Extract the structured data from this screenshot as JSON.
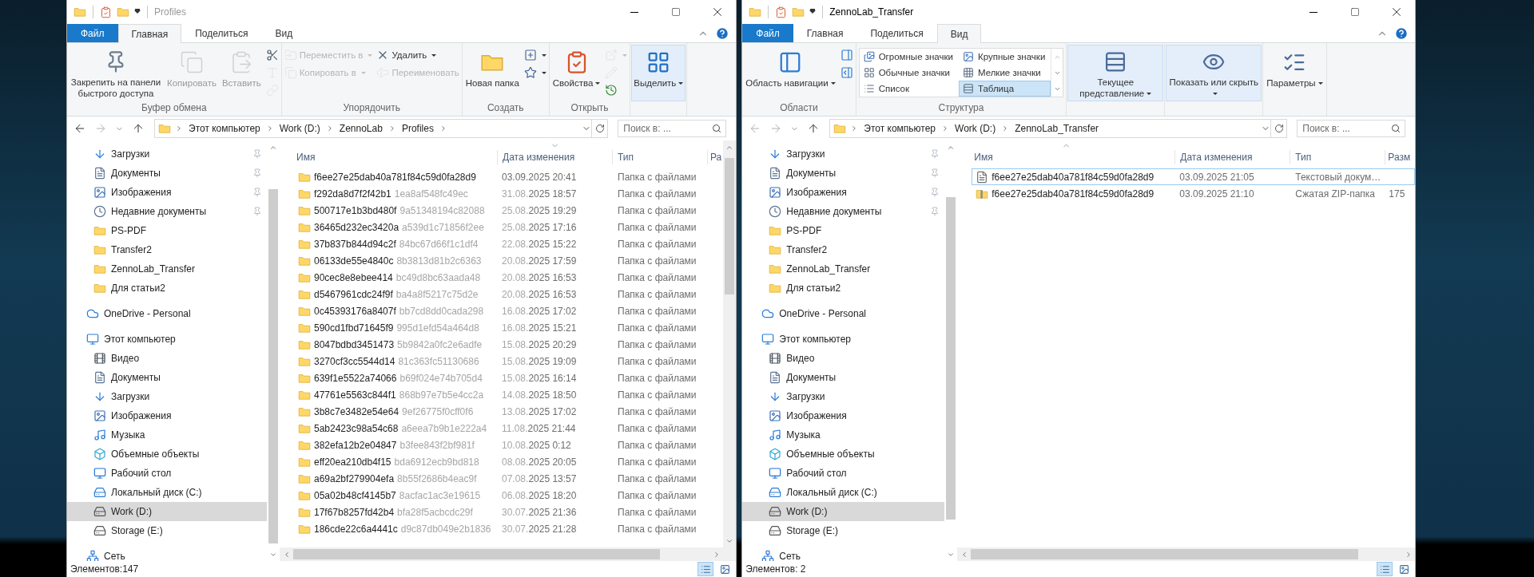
{
  "windows": [
    {
      "title": "Profiles",
      "active": false,
      "tabs": [
        {
          "label": "Файл",
          "kind": "file",
          "selected": false
        },
        {
          "label": "Главная",
          "kind": "tab",
          "selected": true
        },
        {
          "label": "Поделиться",
          "kind": "tab",
          "selected": false
        },
        {
          "label": "Вид",
          "kind": "tab",
          "selected": false
        }
      ],
      "ribbon": [
        {
          "label": "Буфер обмена",
          "items": [
            {
              "kind": "large",
              "label": "Закрепить на панели быстрого доступа",
              "disabled": false,
              "dropdown": false,
              "highlighted": false
            },
            {
              "kind": "large",
              "label": "Копировать",
              "disabled": true,
              "dropdown": false,
              "highlighted": false
            },
            {
              "kind": "large",
              "label": "Вставить",
              "disabled": true,
              "dropdown": false,
              "highlighted": false
            },
            {
              "kind": "stack",
              "items": [
                {
                  "kind": "icon",
                  "disabled": false,
                  "dropdown": false
                },
                {
                  "kind": "icon",
                  "disabled": true,
                  "dropdown": false
                },
                {
                  "kind": "icon",
                  "disabled": true,
                  "dropdown": false
                }
              ]
            }
          ]
        },
        {
          "label": "Упорядочить",
          "items": [
            {
              "kind": "stack",
              "items": [
                {
                  "kind": "small",
                  "label": "Переместить в",
                  "disabled": true,
                  "dropdown": true
                },
                {
                  "kind": "small",
                  "label": "Копировать в",
                  "disabled": true,
                  "dropdown": true
                }
              ]
            },
            {
              "kind": "stack",
              "items": [
                {
                  "kind": "small",
                  "label": "Удалить",
                  "disabled": false,
                  "dropdown": true
                },
                {
                  "kind": "small",
                  "label": "Переименовать",
                  "disabled": true,
                  "dropdown": false
                }
              ]
            }
          ]
        },
        {
          "label": "Создать",
          "items": [
            {
              "kind": "large",
              "label": "Новая папка",
              "disabled": false,
              "dropdown": false,
              "highlighted": false
            },
            {
              "kind": "stack",
              "items": [
                {
                  "kind": "icon",
                  "disabled": false,
                  "dropdown": true
                },
                {
                  "kind": "icon",
                  "disabled": false,
                  "dropdown": true
                }
              ]
            }
          ]
        },
        {
          "label": "Открыть",
          "items": [
            {
              "kind": "large",
              "label": "Свойства",
              "disabled": false,
              "dropdown": true,
              "highlighted": false
            },
            {
              "kind": "stack",
              "items": [
                {
                  "kind": "icon",
                  "disabled": true,
                  "dropdown": true
                },
                {
                  "kind": "icon",
                  "disabled": true,
                  "dropdown": false
                },
                {
                  "kind": "icon",
                  "disabled": false,
                  "dropdown": false
                }
              ]
            }
          ]
        },
        {
          "items": [
            {
              "kind": "large",
              "label": "Выделить",
              "disabled": false,
              "dropdown": true,
              "highlighted": true
            }
          ]
        }
      ],
      "address": {
        "back_disabled": false,
        "forward_disabled": true,
        "path": [
          "Этот компьютер",
          "Work (D:)",
          "ZennoLab",
          "Profiles"
        ],
        "trailing_separator": true
      },
      "search": {
        "placeholder": "Поиск в: ..."
      },
      "nav": {
        "quick_access": [
          {
            "label": "Загрузки",
            "kind": "downloads",
            "pinned": true,
            "selected": false
          },
          {
            "label": "Документы",
            "kind": "documents",
            "pinned": true,
            "selected": false
          },
          {
            "label": "Изображения",
            "kind": "pictures",
            "pinned": true,
            "selected": false
          },
          {
            "label": "Недавние документы",
            "kind": "recent",
            "pinned": true,
            "selected": false
          },
          {
            "label": "PS-PDF",
            "kind": "folder",
            "pinned": false,
            "selected": false
          },
          {
            "label": "Transfer2",
            "kind": "folder",
            "pinned": false,
            "selected": false
          },
          {
            "label": "ZennoLab_Transfer",
            "kind": "folder",
            "pinned": false,
            "selected": false
          },
          {
            "label": "Для статьи2",
            "kind": "folder",
            "pinned": false,
            "selected": false
          }
        ],
        "locations": [
          {
            "label": "OneDrive - Personal",
            "kind": "cloud",
            "selected": false
          },
          {
            "label": "Этот компьютер",
            "kind": "computer",
            "selected": false,
            "children": [
              {
                "label": "Видео",
                "kind": "video",
                "selected": false
              },
              {
                "label": "Документы",
                "kind": "documents",
                "selected": false
              },
              {
                "label": "Загрузки",
                "kind": "downloads",
                "selected": false
              },
              {
                "label": "Изображения",
                "kind": "pictures",
                "selected": false
              },
              {
                "label": "Музыка",
                "kind": "music",
                "selected": false
              },
              {
                "label": "Объемные объекты",
                "kind": "objects",
                "selected": false
              },
              {
                "label": "Рабочий стол",
                "kind": "desktop",
                "selected": false
              },
              {
                "label": "Локальный диск (C:)",
                "kind": "system_drive",
                "selected": false
              },
              {
                "label": "Work (D:)",
                "kind": "drive",
                "selected": true
              },
              {
                "label": "Storage (E:)",
                "kind": "drive",
                "selected": false
              }
            ]
          },
          {
            "label": "Сеть",
            "kind": "network",
            "selected": false
          }
        ]
      },
      "list": {
        "columns": [
          {
            "label": "Имя",
            "sorted": false
          },
          {
            "label": "Дата изменения",
            "sorted": true,
            "descending": true
          },
          {
            "label": "Тип",
            "sorted": false
          },
          {
            "label": "Ра",
            "sorted": false
          }
        ],
        "rows": [
          {
            "kind": "folder",
            "name": "f6ee27e25dab40a781f84c59d0fa28d9",
            "date": "03.09.2025 20:41",
            "type": "Папка с файлами"
          },
          {
            "kind": "folder",
            "name": "f292da8d7f2f42b1",
            "name_faded": "1ea8af548fc49ec",
            "date_faded": "31.08.",
            "date": "2025 18:57",
            "type": "Папка с файлами"
          },
          {
            "kind": "folder",
            "name": "500717e1b3bd480f",
            "name_faded": "9a51348194c82088",
            "date_faded": "25.08.",
            "date": "2025 19:29",
            "type": "Папка с файлами"
          },
          {
            "kind": "folder",
            "name": "36465d232ec3420a",
            "name_faded": "a539d1c71856f2ee",
            "date_faded": "25.08.",
            "date": "2025 17:16",
            "type": "Папка с файлами"
          },
          {
            "kind": "folder",
            "name": "37b837b844d94c2f",
            "name_faded": "84bc67d66f1c1df4",
            "date_faded": "22.08.",
            "date": "2025 15:22",
            "type": "Папка с файлами"
          },
          {
            "kind": "folder",
            "name": "06133de55e4840c",
            "name_faded": "8b3813d81b2c6363",
            "date_faded": "20.08.",
            "date": "2025 17:59",
            "type": "Папка с файлами"
          },
          {
            "kind": "folder",
            "name": "90cec8e8ebee414",
            "name_faded": "bc49d8bc63aada48",
            "date_faded": "20.08.",
            "date": "2025 16:53",
            "type": "Папка с файлами"
          },
          {
            "kind": "folder",
            "name": "d5467961cdc24f9f",
            "name_faded": "ba4a8f5217c75d2e",
            "date_faded": "20.08.",
            "date": "2025 16:53",
            "type": "Папка с файлами"
          },
          {
            "kind": "folder",
            "name": "0c45393176a8407f",
            "name_faded": "bb7cd8dd0cada298",
            "date_faded": "16.08.",
            "date": "2025 17:02",
            "type": "Папка с файлами"
          },
          {
            "kind": "folder",
            "name": "590cd1fbd71645f9",
            "name_faded": "995d1efd54a464d8",
            "date_faded": "16.08.",
            "date": "2025 15:21",
            "type": "Папка с файлами"
          },
          {
            "kind": "folder",
            "name": "8047bdbd3451473",
            "name_faded": "5b9842a0fc2e6adfe",
            "date_faded": "15.08.",
            "date": "2025 20:29",
            "type": "Папка с файлами"
          },
          {
            "kind": "folder",
            "name": "3270cf3cc5544d14",
            "name_faded": "81c363fc51130686",
            "date_faded": "15.08.",
            "date": "2025 19:09",
            "type": "Папка с файлами"
          },
          {
            "kind": "folder",
            "name": "639f1e5522a74066",
            "name_faded": "b69f024e74b705d4",
            "date_faded": "15.08.",
            "date": "2025 16:14",
            "type": "Папка с файлами"
          },
          {
            "kind": "folder",
            "name": "47761e5563c844f1",
            "name_faded": "868b97e7b5e4cc2a",
            "date_faded": "14.08.",
            "date": "2025 18:50",
            "type": "Папка с файлами"
          },
          {
            "kind": "folder",
            "name": "3b8c7e3482e54e64",
            "name_faded": "9ef26775f0cff0f6",
            "date_faded": "13.08.",
            "date": "2025 17:02",
            "type": "Папка с файлами"
          },
          {
            "kind": "folder",
            "name": "5ab2423c98a54c68",
            "name_faded": "a6eea7b9b1e222a4",
            "date_faded": "11.08.",
            "date": "2025 21:44",
            "type": "Папка с файлами"
          },
          {
            "kind": "folder",
            "name": "382efa12b2e04847",
            "name_faded": "b3fee843f2bf981f",
            "date_faded": "10.08.",
            "date": "2025 0:12",
            "type": "Папка с файлами"
          },
          {
            "kind": "folder",
            "name": "eff20ea210db4f15",
            "name_faded": "bda6912ecb9bd818",
            "date_faded": "08.08.",
            "date": "2025 20:05",
            "type": "Папка с файлами"
          },
          {
            "kind": "folder",
            "name": "a69a2bf279904efa",
            "name_faded": "8b55f2686b4eac9f",
            "date_faded": "07.08.",
            "date": "2025 13:57",
            "type": "Папка с файлами"
          },
          {
            "kind": "folder",
            "name": "05a02b48cf4145b7",
            "name_faded": "8acfac1ac3e19615",
            "date_faded": "06.08.",
            "date": "2025 18:20",
            "type": "Папка с файлами"
          },
          {
            "kind": "folder",
            "name": "17f67b8257fd42b4",
            "name_faded": "bfa28f5acbcdc29f",
            "date_faded": "30.07.",
            "date": "2025 21:36",
            "type": "Папка с файлами"
          },
          {
            "kind": "folder",
            "name": "186cde22c6a4441c",
            "name_faded": "d9c87db049e2b1836",
            "date_faded": "30.07.",
            "date": "2025 21:28",
            "type": "Папка с файлами"
          }
        ]
      },
      "status": "Элементов:147",
      "views": [
        {
          "kind": "details",
          "selected": true
        },
        {
          "kind": "tiles",
          "selected": false
        }
      ]
    },
    {
      "title": "ZennoLab_Transfer",
      "active": true,
      "tabs": [
        {
          "label": "Файл",
          "kind": "file",
          "selected": false
        },
        {
          "label": "Главная",
          "kind": "tab",
          "selected": false
        },
        {
          "label": "Поделиться",
          "kind": "tab",
          "selected": false
        },
        {
          "label": "Вид",
          "kind": "tab",
          "selected": true
        }
      ],
      "ribbon": [
        {
          "label": "Области",
          "items": [
            {
              "kind": "large",
              "label": "Область навигации",
              "disabled": false,
              "dropdown": true,
              "highlighted": false
            },
            {
              "kind": "stack",
              "items": [
                {
                  "kind": "icon",
                  "disabled": false,
                  "dropdown": false
                },
                {
                  "kind": "icon",
                  "disabled": false,
                  "dropdown": false
                }
              ]
            }
          ]
        },
        {
          "label": "Структура",
          "items": [
            {
              "kind": "gallery",
              "options": [
                {
                  "label": "Огромные значки",
                  "selected": false
                },
                {
                  "label": "Крупные значки",
                  "selected": false
                },
                {
                  "label": "Обычные значки",
                  "selected": false
                },
                {
                  "label": "Мелкие значки",
                  "selected": false
                },
                {
                  "label": "Список",
                  "selected": false
                },
                {
                  "label": "Таблица",
                  "selected": true
                }
              ]
            }
          ]
        },
        {
          "items": [
            {
              "kind": "large",
              "label": "Текущее представление",
              "disabled": false,
              "dropdown": true,
              "highlighted": true
            }
          ]
        },
        {
          "items": [
            {
              "kind": "large",
              "label": "Показать или скрыть",
              "disabled": false,
              "dropdown": true,
              "highlighted": true
            }
          ]
        },
        {
          "items": [
            {
              "kind": "large",
              "label": "Параметры",
              "disabled": false,
              "dropdown": true,
              "highlighted": false
            }
          ]
        }
      ],
      "address": {
        "back_disabled": true,
        "forward_disabled": true,
        "path": [
          "Этот компьютер",
          "Work (D:)",
          "ZennoLab_Transfer"
        ],
        "trailing_separator": false
      },
      "search": {
        "placeholder": "Поиск в: ..."
      },
      "nav": {
        "quick_access": [
          {
            "label": "Загрузки",
            "kind": "downloads",
            "pinned": true,
            "selected": false
          },
          {
            "label": "Документы",
            "kind": "documents",
            "pinned": true,
            "selected": false
          },
          {
            "label": "Изображения",
            "kind": "pictures",
            "pinned": true,
            "selected": false
          },
          {
            "label": "Недавние документы",
            "kind": "recent",
            "pinned": true,
            "selected": false
          },
          {
            "label": "PS-PDF",
            "kind": "folder",
            "pinned": false,
            "selected": false
          },
          {
            "label": "Transfer2",
            "kind": "folder",
            "pinned": false,
            "selected": false
          },
          {
            "label": "ZennoLab_Transfer",
            "kind": "folder",
            "pinned": false,
            "selected": false
          },
          {
            "label": "Для статьи2",
            "kind": "folder",
            "pinned": false,
            "selected": false
          }
        ],
        "locations": [
          {
            "label": "OneDrive - Personal",
            "kind": "cloud",
            "selected": false
          },
          {
            "label": "Этот компьютер",
            "kind": "computer",
            "selected": false,
            "children": [
              {
                "label": "Видео",
                "kind": "video",
                "selected": false
              },
              {
                "label": "Документы",
                "kind": "documents",
                "selected": false
              },
              {
                "label": "Загрузки",
                "kind": "downloads",
                "selected": false
              },
              {
                "label": "Изображения",
                "kind": "pictures",
                "selected": false
              },
              {
                "label": "Музыка",
                "kind": "music",
                "selected": false
              },
              {
                "label": "Объемные объекты",
                "kind": "objects",
                "selected": false
              },
              {
                "label": "Рабочий стол",
                "kind": "desktop",
                "selected": false
              },
              {
                "label": "Локальный диск (C:)",
                "kind": "system_drive",
                "selected": false
              },
              {
                "label": "Work (D:)",
                "kind": "drive",
                "selected": true
              },
              {
                "label": "Storage (E:)",
                "kind": "drive",
                "selected": false
              }
            ]
          },
          {
            "label": "Сеть",
            "kind": "network",
            "selected": false
          }
        ]
      },
      "list": {
        "columns": [
          {
            "label": "Имя",
            "sorted": true,
            "descending": false
          },
          {
            "label": "Дата изменения",
            "sorted": false
          },
          {
            "label": "Тип",
            "sorted": false
          },
          {
            "label": "Разм",
            "sorted": false
          }
        ],
        "rows": [
          {
            "kind": "text",
            "name": "f6ee27e25dab40a781f84c59d0fa28d9",
            "date": "03.09.2025 21:05",
            "type": "Текстовый докум…",
            "focused": true
          },
          {
            "kind": "zip",
            "name": "f6ee27e25dab40a781f84c59d0fa28d9",
            "date": "03.09.2025 21:10",
            "type": "Сжатая ZIP-папка",
            "size": "175",
            "focused": false
          }
        ]
      },
      "status": "Элементов: 2",
      "views": [
        {
          "kind": "details",
          "selected": true
        },
        {
          "kind": "tiles",
          "selected": false
        }
      ]
    }
  ]
}
